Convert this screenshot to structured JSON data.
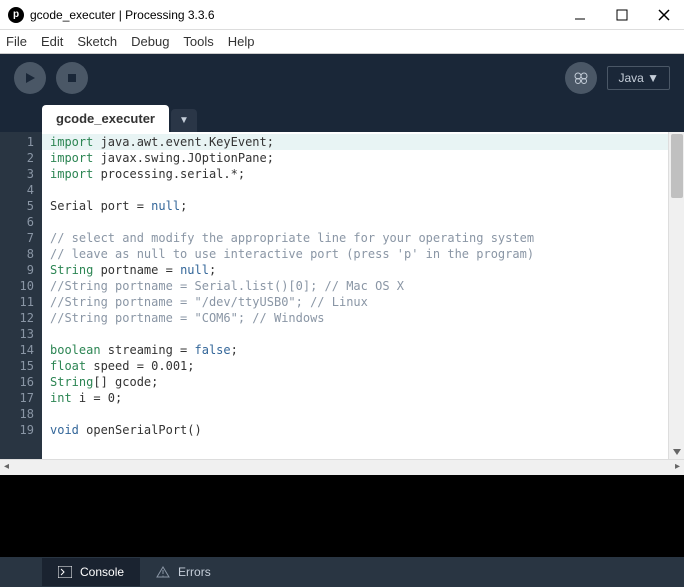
{
  "window": {
    "title": "gcode_executer | Processing 3.3.6"
  },
  "menu": {
    "file": "File",
    "edit": "Edit",
    "sketch": "Sketch",
    "debug": "Debug",
    "tools": "Tools",
    "help": "Help"
  },
  "toolbar": {
    "mode": "Java ▼"
  },
  "tab": {
    "name": "gcode_executer",
    "dropdown": "▼"
  },
  "code": {
    "lines": [
      {
        "n": 1,
        "tokens": [
          [
            "kw-import",
            "import"
          ],
          [
            "",
            " java.awt.event.KeyEvent;"
          ]
        ]
      },
      {
        "n": 2,
        "tokens": [
          [
            "kw-import",
            "import"
          ],
          [
            "",
            " javax.swing.JOptionPane;"
          ]
        ]
      },
      {
        "n": 3,
        "tokens": [
          [
            "kw-import",
            "import"
          ],
          [
            "",
            " processing.serial.*;"
          ]
        ]
      },
      {
        "n": 4,
        "tokens": [
          [
            "",
            ""
          ]
        ]
      },
      {
        "n": 5,
        "tokens": [
          [
            "",
            "Serial port = "
          ],
          [
            "kw-null",
            "null"
          ],
          [
            "",
            ";"
          ]
        ]
      },
      {
        "n": 6,
        "tokens": [
          [
            "",
            ""
          ]
        ]
      },
      {
        "n": 7,
        "tokens": [
          [
            "comment",
            "// select and modify the appropriate line for your operating system"
          ]
        ]
      },
      {
        "n": 8,
        "tokens": [
          [
            "comment",
            "// leave as null to use interactive port (press 'p' in the program)"
          ]
        ]
      },
      {
        "n": 9,
        "tokens": [
          [
            "kw-type",
            "String"
          ],
          [
            "",
            " portname = "
          ],
          [
            "kw-null",
            "null"
          ],
          [
            "",
            ";"
          ]
        ]
      },
      {
        "n": 10,
        "tokens": [
          [
            "comment",
            "//String portname = Serial.list()[0]; // Mac OS X"
          ]
        ]
      },
      {
        "n": 11,
        "tokens": [
          [
            "comment",
            "//String portname = \"/dev/ttyUSB0\"; // Linux"
          ]
        ]
      },
      {
        "n": 12,
        "tokens": [
          [
            "comment",
            "//String portname = \"COM6\"; // Windows"
          ]
        ]
      },
      {
        "n": 13,
        "tokens": [
          [
            "",
            ""
          ]
        ]
      },
      {
        "n": 14,
        "tokens": [
          [
            "kw-bool",
            "boolean"
          ],
          [
            "",
            " streaming = "
          ],
          [
            "kw-false",
            "false"
          ],
          [
            "",
            ";"
          ]
        ]
      },
      {
        "n": 15,
        "tokens": [
          [
            "kw-type",
            "float"
          ],
          [
            "",
            " speed = 0.001;"
          ]
        ]
      },
      {
        "n": 16,
        "tokens": [
          [
            "kw-type",
            "String"
          ],
          [
            "",
            "[] gcode;"
          ]
        ]
      },
      {
        "n": 17,
        "tokens": [
          [
            "kw-type",
            "int"
          ],
          [
            "",
            " i = 0;"
          ]
        ]
      },
      {
        "n": 18,
        "tokens": [
          [
            "",
            ""
          ]
        ]
      },
      {
        "n": 19,
        "tokens": [
          [
            "kw-void",
            "void"
          ],
          [
            "",
            " openSerialPort()"
          ]
        ]
      }
    ]
  },
  "bottom": {
    "console": "Console",
    "errors": "Errors"
  }
}
